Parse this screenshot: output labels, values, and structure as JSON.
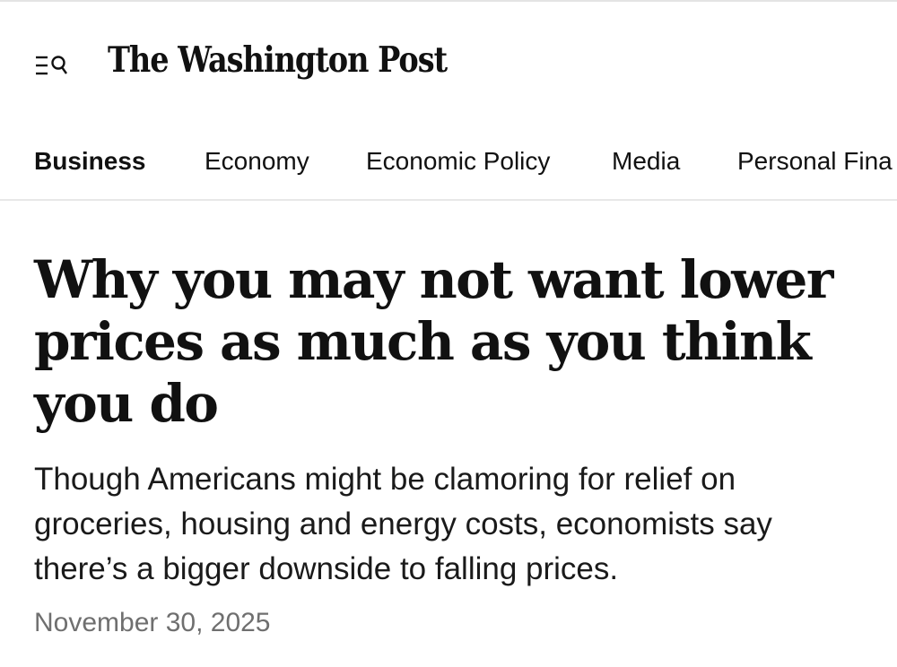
{
  "masthead": {
    "logo_text": "The Washington Post",
    "menu_search_icon": "menu-search-icon"
  },
  "section_nav": {
    "items": [
      {
        "label": "Business",
        "active": true
      },
      {
        "label": "Economy",
        "active": false
      },
      {
        "label": "Economic Policy",
        "active": false
      },
      {
        "label": "Media",
        "active": false
      },
      {
        "label": "Personal Fina",
        "active": false
      }
    ]
  },
  "article": {
    "headline": "Why you may not want lower prices as much as you think you do",
    "dek": "Though Americans might be clamoring for relief on groceries, housing and energy costs, economists say there’s a bigger downside to falling prices.",
    "date": "November 30, 2025"
  },
  "colors": {
    "text": "#111111",
    "date_gray": "#6f6f6f",
    "divider": "#e8e8e8"
  }
}
